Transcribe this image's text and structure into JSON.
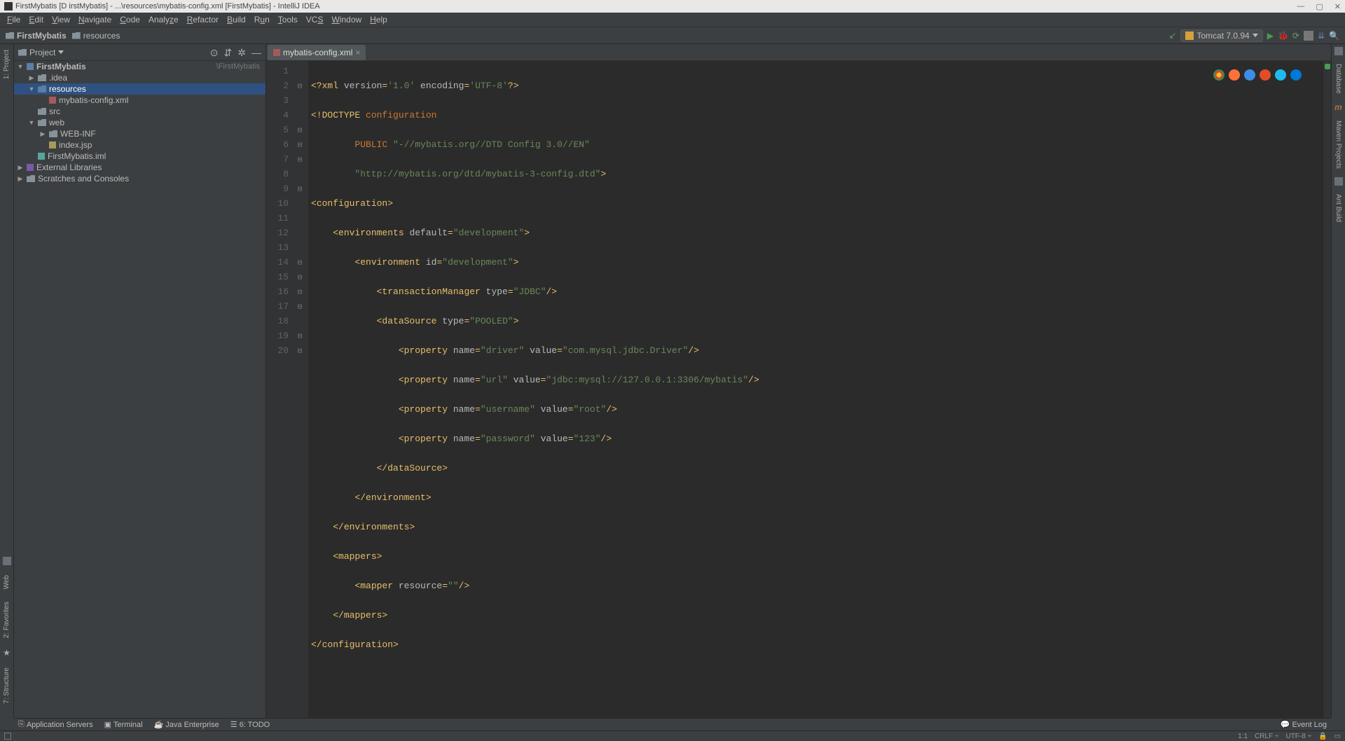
{
  "title": "FirstMybatis [D                            irstMybatis] - ...\\resources\\mybatis-config.xml [FirstMybatis] - IntelliJ IDEA",
  "menu": [
    "File",
    "Edit",
    "View",
    "Navigate",
    "Code",
    "Analyze",
    "Refactor",
    "Build",
    "Run",
    "Tools",
    "VCS",
    "Window",
    "Help"
  ],
  "breadcrumbs": [
    "FirstMybatis",
    "resources"
  ],
  "run_config": "Tomcat 7.0.94",
  "project_panel": {
    "title": "Project"
  },
  "tree": {
    "root": {
      "label": "FirstMybatis",
      "path": "\\FirstMybatis"
    },
    "items": [
      {
        "depth": 1,
        "arrow": "closed",
        "icon": "fold",
        "label": ".idea"
      },
      {
        "depth": 1,
        "arrow": "open",
        "icon": "fold-res",
        "label": "resources",
        "sel": true
      },
      {
        "depth": 2,
        "arrow": "none",
        "icon": "xml",
        "label": "mybatis-config.xml"
      },
      {
        "depth": 1,
        "arrow": "none",
        "icon": "fold",
        "label": "src"
      },
      {
        "depth": 1,
        "arrow": "open",
        "icon": "fold",
        "label": "web"
      },
      {
        "depth": 2,
        "arrow": "closed",
        "icon": "fold",
        "label": "WEB-INF"
      },
      {
        "depth": 2,
        "arrow": "none",
        "icon": "jsp",
        "label": "index.jsp"
      },
      {
        "depth": 1,
        "arrow": "none",
        "icon": "iml",
        "label": "FirstMybatis.iml"
      }
    ],
    "external": "External Libraries",
    "scratches": "Scratches and Consoles"
  },
  "tab": {
    "label": "mybatis-config.xml"
  },
  "bottom_tabs": [
    "Application Servers",
    "Terminal",
    "Java Enterprise",
    "6: TODO"
  ],
  "event_log": "Event Log",
  "status": {
    "pos": "1:1",
    "sep": "CRLF",
    "enc": "UTF-8"
  },
  "right_tools": [
    "Database",
    "Maven Projects",
    "Ant Build"
  ],
  "left_tools_top": [
    "1: Project"
  ],
  "left_tools_bot": [
    "Web",
    "2: Favorites",
    "7: Structure"
  ],
  "code": {
    "l1": {
      "a": "<?xml ",
      "b": "version",
      "c": "=",
      "d": "'1.0'",
      "e": " encoding",
      "f": "=",
      "g": "'UTF-8'",
      "h": "?>"
    },
    "l2": {
      "a": "<!DOCTYPE ",
      "b": "configuration"
    },
    "l3": {
      "a": "        PUBLIC ",
      "b": "\"-//mybatis.org//DTD Config 3.0//EN\""
    },
    "l4": {
      "a": "        ",
      "b": "\"http://mybatis.org/dtd/mybatis-3-config.dtd\"",
      "c": ">"
    },
    "l5": {
      "a": "<",
      "b": "configuration",
      "c": ">"
    },
    "l6": {
      "a": "    <",
      "b": "environments ",
      "c": "default",
      "d": "=",
      "e": "\"development\"",
      "f": ">"
    },
    "l7": {
      "a": "        <",
      "b": "environment ",
      "c": "id",
      "d": "=",
      "e": "\"development\"",
      "f": ">"
    },
    "l8": {
      "a": "            <",
      "b": "transactionManager ",
      "c": "type",
      "d": "=",
      "e": "\"JDBC\"",
      "f": "/>"
    },
    "l9": {
      "a": "            <",
      "b": "dataSource ",
      "c": "type",
      "d": "=",
      "e": "\"POOLED\"",
      "f": ">"
    },
    "l10": {
      "a": "                <",
      "b": "property ",
      "c": "name",
      "d": "=",
      "e": "\"driver\"",
      "f": " value",
      "g": "=",
      "h": "\"com.mysql.jdbc.Driver\"",
      "i": "/>"
    },
    "l11": {
      "a": "                <",
      "b": "property ",
      "c": "name",
      "d": "=",
      "e": "\"url\"",
      "f": " value",
      "g": "=",
      "h": "\"jdbc:mysql://127.0.0.1:3306/mybatis\"",
      "i": "/>"
    },
    "l12": {
      "a": "                <",
      "b": "property ",
      "c": "name",
      "d": "=",
      "e": "\"username\"",
      "f": " value",
      "g": "=",
      "h": "\"root\"",
      "i": "/>"
    },
    "l13": {
      "a": "                <",
      "b": "property ",
      "c": "name",
      "d": "=",
      "e": "\"password\"",
      "f": " value",
      "g": "=",
      "h": "\"123\"",
      "i": "/>"
    },
    "l14": {
      "a": "            </",
      "b": "dataSource",
      "c": ">"
    },
    "l15": {
      "a": "        </",
      "b": "environment",
      "c": ">"
    },
    "l16": {
      "a": "    </",
      "b": "environments",
      "c": ">"
    },
    "l17": {
      "a": "    <",
      "b": "mappers",
      "c": ">"
    },
    "l18": {
      "a": "        <",
      "b": "mapper ",
      "c": "resource",
      "d": "=",
      "e": "\"\"",
      "f": "/>"
    },
    "l19": {
      "a": "    </",
      "b": "mappers",
      "c": ">"
    },
    "l20": {
      "a": "</",
      "b": "configuration",
      "c": ">"
    }
  }
}
